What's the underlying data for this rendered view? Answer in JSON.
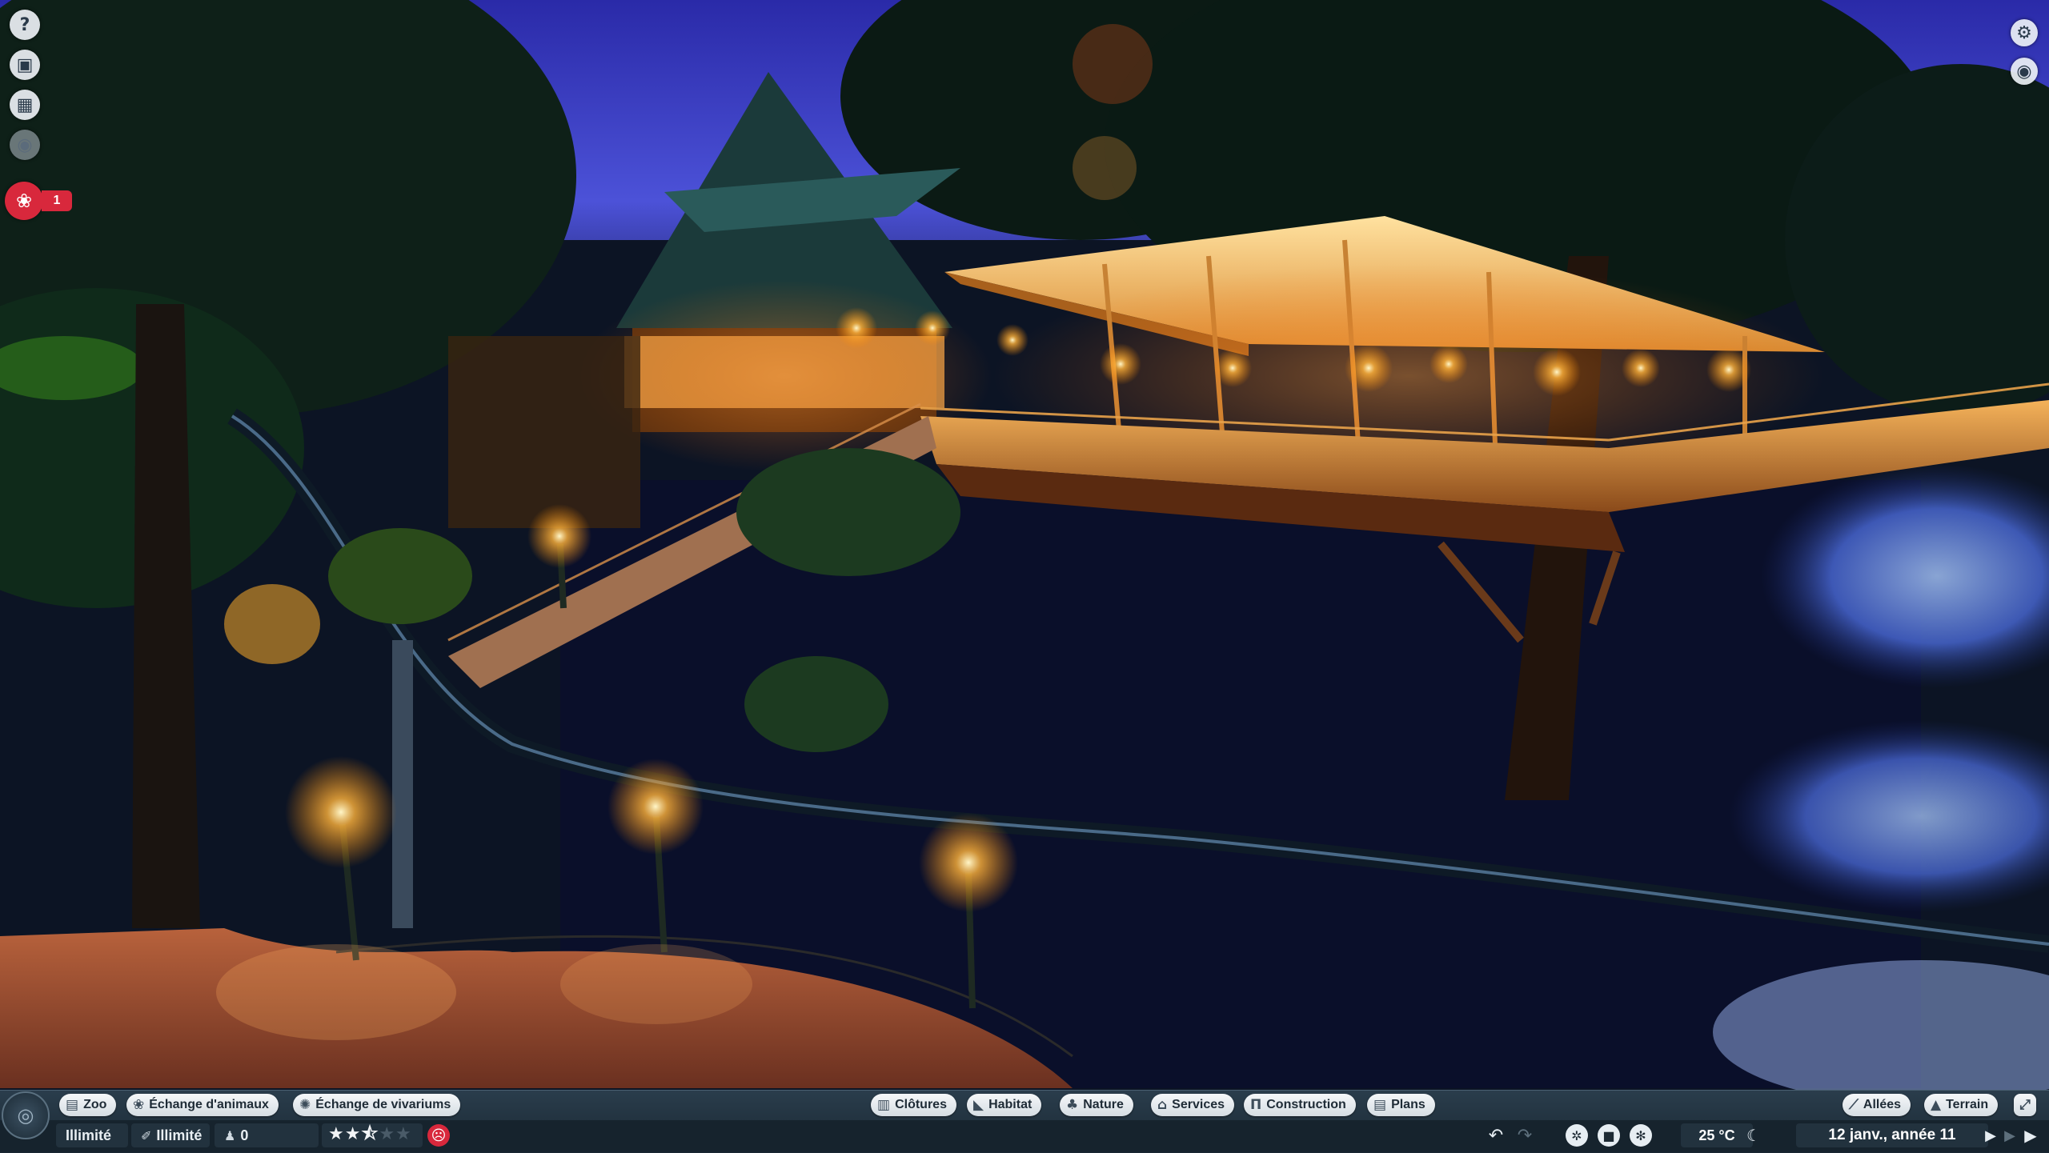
{
  "left_toolbar": {
    "help": "?",
    "notification_count": "1"
  },
  "hud": {
    "left_tabs": [
      {
        "label": "Zoo",
        "icon": "zoo-icon"
      },
      {
        "label": "Échange d'animaux",
        "icon": "paw-icon"
      },
      {
        "label": "Échange de vivariums",
        "icon": "vivarium-icon"
      }
    ],
    "build_tabs": [
      {
        "label": "Clôtures",
        "icon": "fence-icon"
      },
      {
        "label": "Habitat",
        "icon": "habitat-icon"
      },
      {
        "label": "Nature",
        "icon": "tree-icon"
      },
      {
        "label": "Services",
        "icon": "shop-icon"
      },
      {
        "label": "Construction",
        "icon": "building-icon"
      },
      {
        "label": "Plans",
        "icon": "blueprint-icon"
      }
    ],
    "right_tabs": [
      {
        "label": "Allées",
        "icon": "path-icon"
      },
      {
        "label": "Terrain",
        "icon": "terrain-icon"
      }
    ],
    "money": "Illimité",
    "conservation_credits": "Illimité",
    "guests": "0",
    "zoo_rating_stars": 2.5,
    "zoo_rating_max": 5,
    "temperature": "25 °C",
    "date": "12 janv., année 11"
  },
  "colors": {
    "alert": "#d8283c",
    "hud_background": "#1a2833",
    "pill_background": "#e8edf1"
  }
}
